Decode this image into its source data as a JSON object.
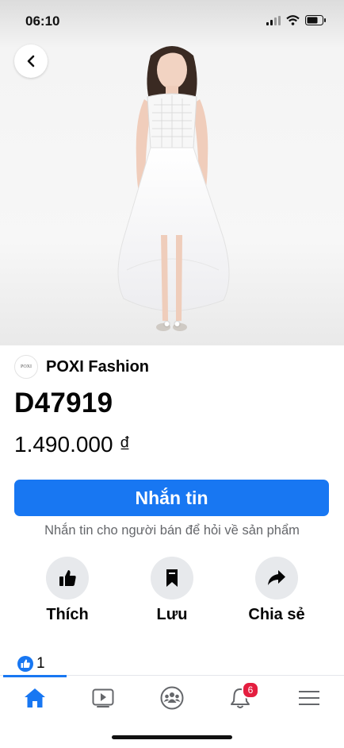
{
  "status": {
    "time": "06:10",
    "icons": [
      "cellular-signal-icon",
      "wifi-icon",
      "battery-icon"
    ]
  },
  "hero": {
    "image": "product-photo-white-dress",
    "page_dots": 2,
    "active_dot": 1
  },
  "seller": {
    "logo_text": "POXI",
    "name": "POXI Fashion"
  },
  "product": {
    "title": "D47919",
    "price": "1.490.000 ₫"
  },
  "cta": {
    "message_label": "Nhắn tin",
    "hint": "Nhắn tin cho người bán để hỏi về sản phẩm"
  },
  "actions": [
    {
      "icon": "thumbs-up-icon",
      "label": "Thích"
    },
    {
      "icon": "bookmark-icon",
      "label": "Lưu"
    },
    {
      "icon": "share-icon",
      "label": "Chia sẻ"
    }
  ],
  "reactions": {
    "icon": "like-reaction-icon",
    "count": "1"
  },
  "nav": {
    "items": [
      "home-icon",
      "watch-icon",
      "groups-icon",
      "notifications-icon",
      "menu-icon"
    ],
    "active": "home-icon",
    "notification_badge": "6"
  },
  "colors": {
    "accent": "#1877f2",
    "action_circle": "#e7e9ec",
    "secondary_text": "#65676b",
    "badge": "#e41e3f"
  }
}
